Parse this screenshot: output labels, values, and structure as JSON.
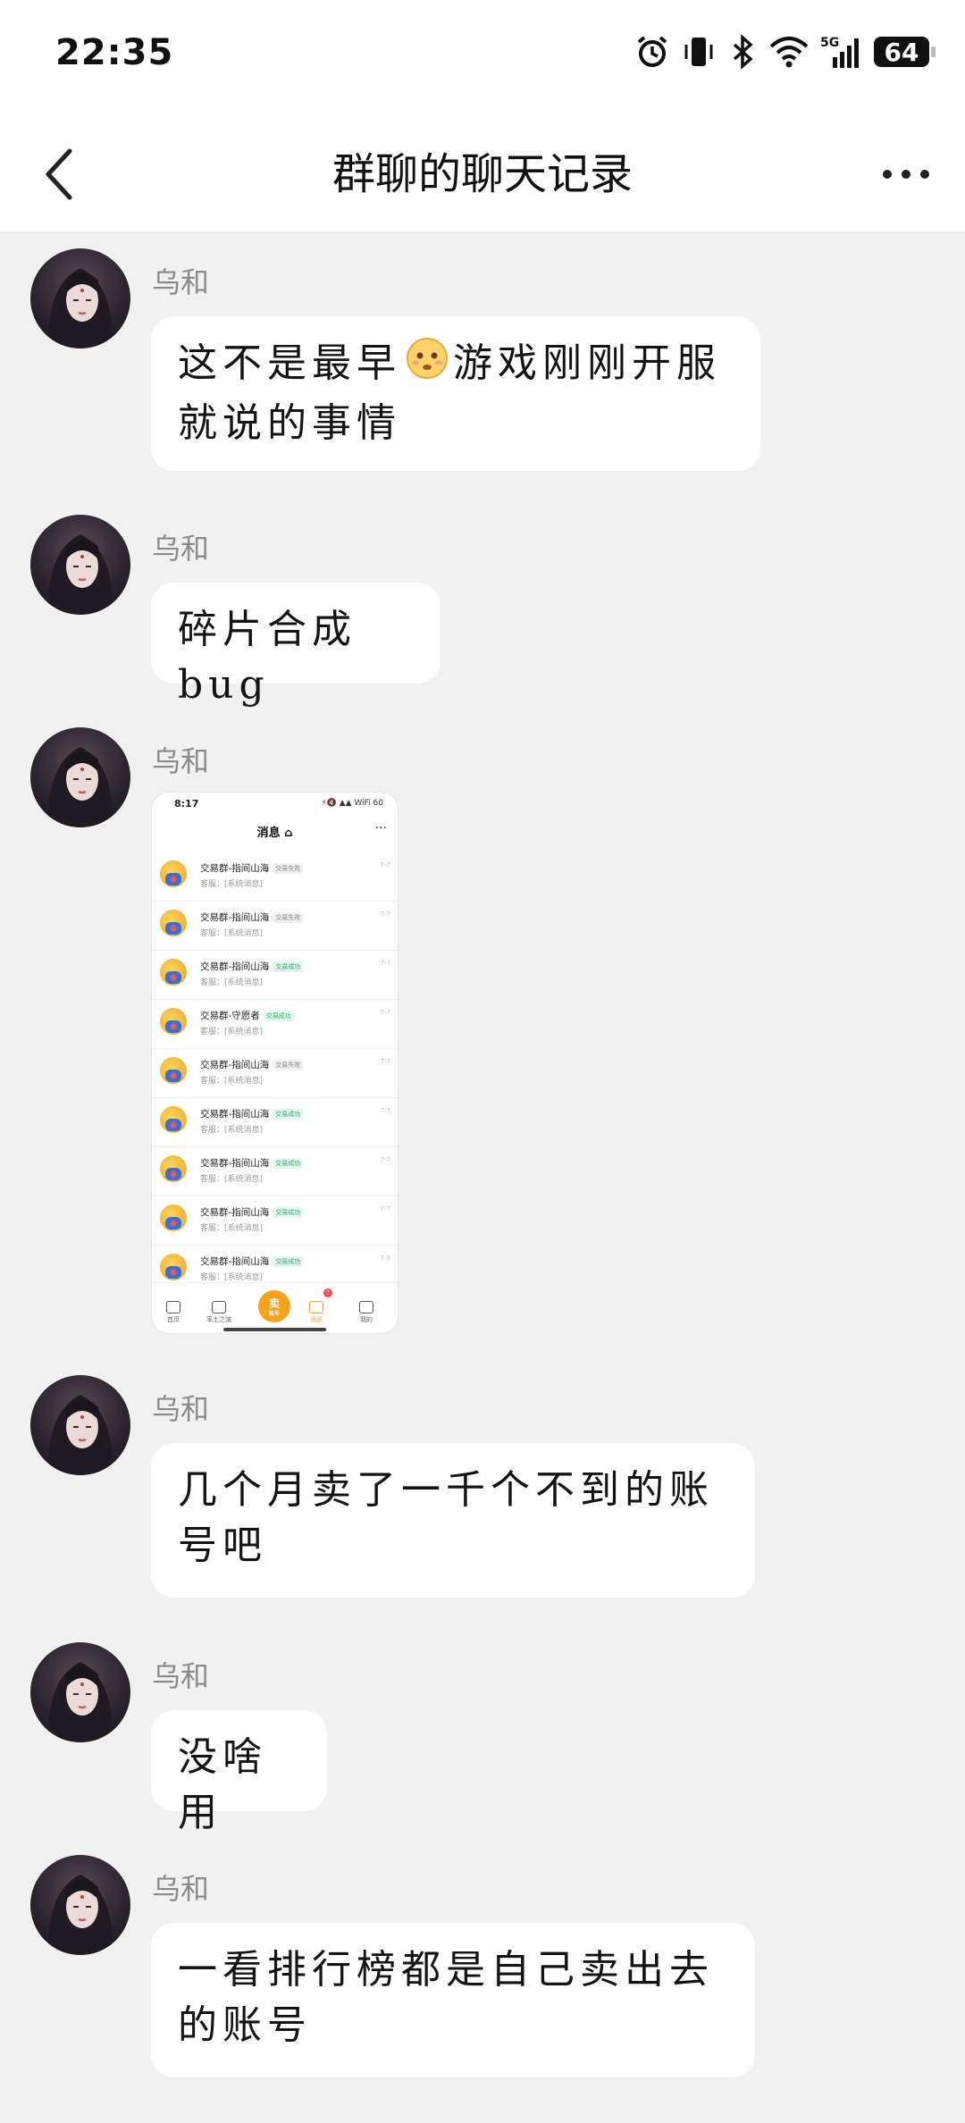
{
  "status_bar": {
    "time": "22:35",
    "battery": "64",
    "network": "5G",
    "icons": [
      "alarm-icon",
      "vibrate-icon",
      "bluetooth-icon",
      "wifi-icon",
      "signal-icon",
      "battery-icon"
    ]
  },
  "nav": {
    "title": "群聊的聊天记录",
    "back_icon": "chevron-left-icon",
    "more_icon": "more-horizontal-icon"
  },
  "messages": [
    {
      "sender": "乌和",
      "type": "text",
      "text_before_emoji": "这不是最早",
      "emoji": "dazed-face-emoji",
      "text_after_emoji": "游戏刚刚开服就说的事情"
    },
    {
      "sender": "乌和",
      "type": "text",
      "text": "碎片合成bug"
    },
    {
      "sender": "乌和",
      "type": "image"
    },
    {
      "sender": "乌和",
      "type": "text",
      "text": "几个月卖了一千个不到的账号吧"
    },
    {
      "sender": "乌和",
      "type": "text",
      "text": "没啥用"
    },
    {
      "sender": "乌和",
      "type": "text",
      "text": "一看排行榜都是自己卖出去的账号"
    }
  ],
  "image_preview": {
    "time": "8:17",
    "status": "⚡🔇 ▲▲ WiFi 60",
    "title": "消息 ⌂",
    "more": "···",
    "rows": [
      {
        "name": "交易群-指间山海",
        "tag": "交易失败",
        "tag_kind": "fail",
        "sub": "客服：[系统消息]",
        "date": "7-7"
      },
      {
        "name": "交易群-指间山海",
        "tag": "交易失败",
        "tag_kind": "fail",
        "sub": "客服：[系统消息]",
        "date": "7-7"
      },
      {
        "name": "交易群-指间山海",
        "tag": "交易成功",
        "tag_kind": "ok",
        "sub": "客服：[系统消息]",
        "date": "7-7"
      },
      {
        "name": "交易群-守愿者",
        "tag": "交易成功",
        "tag_kind": "ok",
        "sub": "客服：[系统消息]",
        "date": "7-7"
      },
      {
        "name": "交易群-指间山海",
        "tag": "交易失败",
        "tag_kind": "fail",
        "sub": "客服：[系统消息]",
        "date": "7-7"
      },
      {
        "name": "交易群-指间山海",
        "tag": "交易成功",
        "tag_kind": "ok",
        "sub": "客服：[系统消息]",
        "date": "7-7"
      },
      {
        "name": "交易群-指间山海",
        "tag": "交易成功",
        "tag_kind": "ok",
        "sub": "客服：[系统消息]",
        "date": "7-7"
      },
      {
        "name": "交易群-指间山海",
        "tag": "交易成功",
        "tag_kind": "ok",
        "sub": "客服：[系统消息]",
        "date": "7-7"
      },
      {
        "name": "交易群-指间山海",
        "tag": "交易成功",
        "tag_kind": "ok",
        "sub": "客服：[系统消息]",
        "date": "7-5"
      }
    ],
    "tabs": [
      "首页",
      "率土之滨",
      "卖",
      "消息",
      "我的"
    ],
    "sell_sub": "账号",
    "badge": "7"
  }
}
